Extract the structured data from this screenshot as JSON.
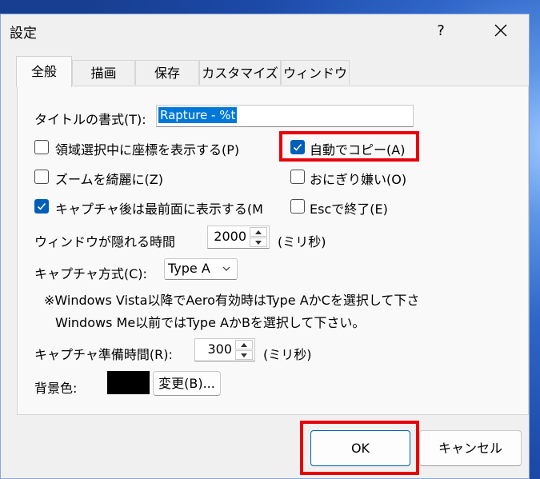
{
  "window": {
    "title": "設定",
    "help_label": "?"
  },
  "tabs": [
    {
      "label": "全般",
      "active": true
    },
    {
      "label": "描画"
    },
    {
      "label": "保存"
    },
    {
      "label": "カスタマイズ"
    },
    {
      "label": "ウィンドウ"
    }
  ],
  "general": {
    "title_format_label": "タイトルの書式(T):",
    "title_format_value": "Rapture - %t",
    "checkboxes": {
      "region_coords": {
        "label": "領域選択中に座標を表示する(P)",
        "checked": false
      },
      "auto_copy": {
        "label": "自動でコピー(A)",
        "checked": true
      },
      "zoom_smooth": {
        "label": "ズームを綺麗に(Z)",
        "checked": false
      },
      "hate_onigiri": {
        "label": "おにぎり嫌い(O)",
        "checked": false
      },
      "topmost_after": {
        "label": "キャプチャ後は最前面に表示する(M",
        "checked": true
      },
      "esc_exit": {
        "label": "Escで終了(E)",
        "checked": false
      }
    },
    "hide_time_label": "ウィンドウが隠れる時間",
    "hide_time_value": "2000",
    "hide_time_unit": "(ミリ秒)",
    "capture_method_label": "キャプチャ方式(C):",
    "capture_method_value": "Type A",
    "note_line1": "※Windows Vista以降でAero有効時はType AかCを選択して下さ",
    "note_line2": "Windows Me以前ではType AかBを選択して下さい。",
    "prep_time_label": "キャプチャ準備時間(R):",
    "prep_time_value": "300",
    "prep_time_unit": "(ミリ秒)",
    "bg_color_label": "背景色:",
    "bg_color_value": "#000000",
    "change_button": "変更(B)..."
  },
  "footer": {
    "ok": "OK",
    "cancel": "キャンセル"
  },
  "colors": {
    "accent": "#005fb8",
    "highlight": "#e8000b"
  }
}
